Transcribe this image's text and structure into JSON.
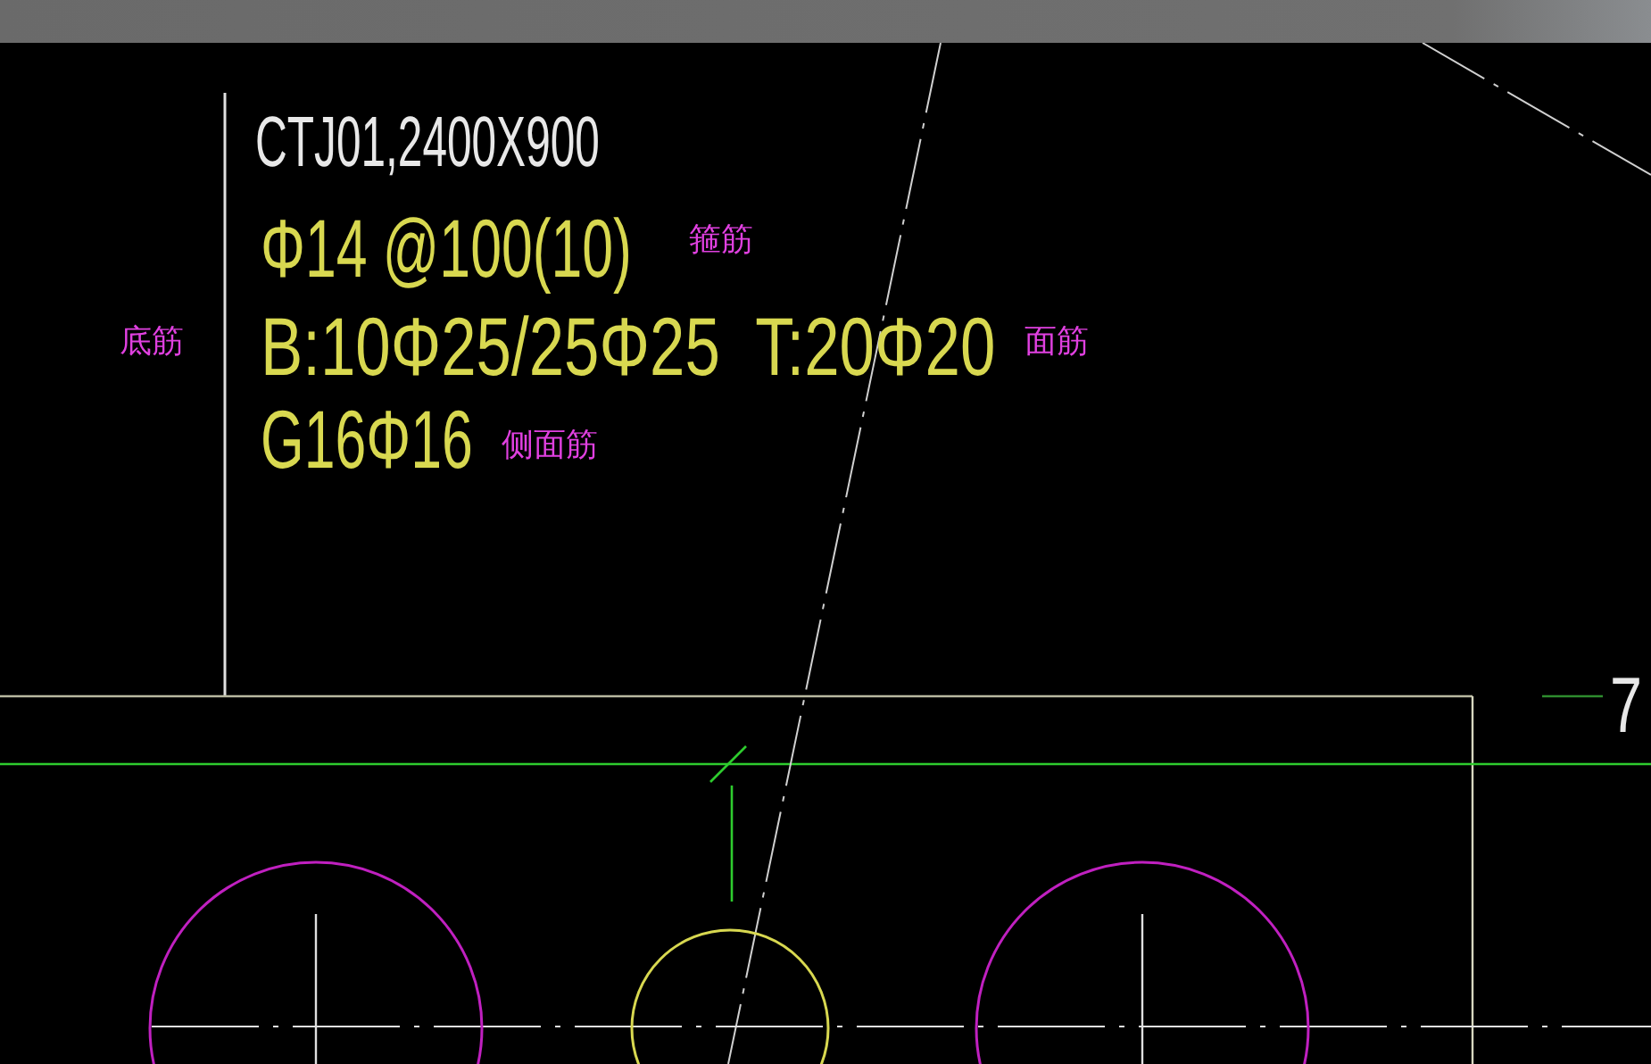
{
  "drawing_labels": [
    {
      "text": "CTJ01,2400X900",
      "kind": "title"
    },
    {
      "text": "Φ14 @100(10)",
      "kind": "rebar"
    },
    {
      "text": "B:10Φ25/25Φ25  T:20Φ20",
      "kind": "rebar"
    },
    {
      "text": "G16Φ16",
      "kind": "rebar"
    }
  ],
  "annotations": [
    {
      "text": "箍筋"
    },
    {
      "text": "底筋"
    },
    {
      "text": "面筋"
    },
    {
      "text": "侧面筋"
    }
  ],
  "axis_label": "7"
}
